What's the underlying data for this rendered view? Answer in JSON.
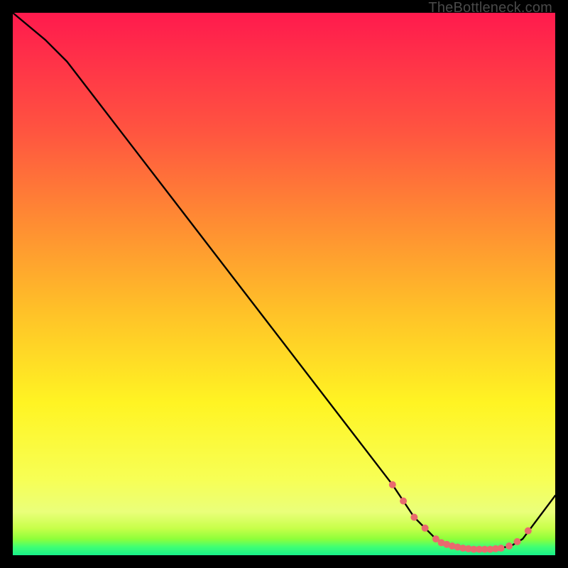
{
  "watermark": "TheBottleneck.com",
  "chart_data": {
    "type": "line",
    "title": "",
    "xlabel": "",
    "ylabel": "",
    "xlim": [
      0,
      100
    ],
    "ylim": [
      0,
      100
    ],
    "series": [
      {
        "name": "curve",
        "x": [
          0,
          6,
          10,
          20,
          30,
          40,
          50,
          60,
          70,
          74,
          78,
          80,
          82,
          84,
          86,
          88,
          90,
          92,
          94,
          100
        ],
        "values": [
          100,
          95,
          91,
          78,
          65,
          52,
          39,
          26,
          13,
          7,
          3,
          2,
          1.5,
          1.2,
          1.1,
          1.1,
          1.3,
          1.8,
          3,
          11
        ]
      }
    ],
    "markers": {
      "name": "highlighted-points",
      "color": "#e96a6e",
      "x": [
        70,
        72,
        74,
        76,
        78,
        79,
        80,
        81,
        82,
        83,
        84,
        85,
        86,
        87,
        88,
        89,
        90,
        91.5,
        93,
        95
      ],
      "values": [
        13,
        10,
        7,
        5,
        3,
        2.3,
        2,
        1.7,
        1.5,
        1.3,
        1.2,
        1.1,
        1.1,
        1.1,
        1.1,
        1.2,
        1.3,
        1.7,
        2.5,
        4.5
      ]
    }
  }
}
